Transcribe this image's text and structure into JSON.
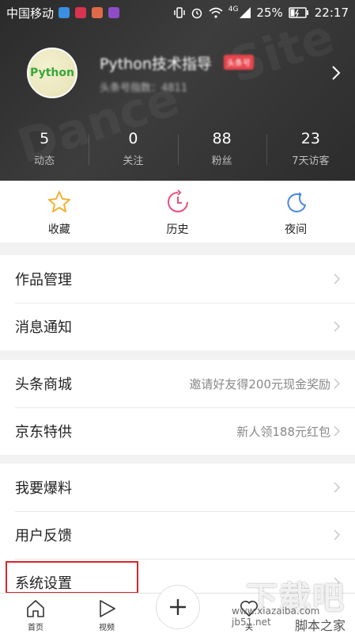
{
  "status_bar": {
    "carrier": "中国移动",
    "network": "4G",
    "battery": "25%",
    "time": "22:17",
    "app_icon_colors": [
      "#3b8fe0",
      "#d9334f",
      "#e0694a",
      "#8f4cc9"
    ]
  },
  "profile": {
    "avatar_text": "Python",
    "name": "Python技术指导",
    "badge": "头条号",
    "subtitle": "头条号指数：4811"
  },
  "stats": [
    {
      "value": "5",
      "label": "动态"
    },
    {
      "value": "0",
      "label": "关注"
    },
    {
      "value": "88",
      "label": "粉丝"
    },
    {
      "value": "23",
      "label": "7天访客"
    }
  ],
  "quick_actions": [
    {
      "label": "收藏",
      "icon": "star-icon",
      "color": "#f2b233"
    },
    {
      "label": "历史",
      "icon": "clock-icon",
      "color": "#e9507c"
    },
    {
      "label": "夜间",
      "icon": "moon-icon",
      "color": "#4a86e0"
    }
  ],
  "groups": [
    [
      {
        "title": "作品管理",
        "extra": ""
      },
      {
        "title": "消息通知",
        "extra": ""
      }
    ],
    [
      {
        "title": "头条商城",
        "extra": "邀请好友得200元现金奖励"
      },
      {
        "title": "京东特供",
        "extra": "新人领188元红包"
      }
    ],
    [
      {
        "title": "我要爆料",
        "extra": ""
      },
      {
        "title": "用户反馈",
        "extra": ""
      },
      {
        "title": "系统设置",
        "extra": ""
      }
    ]
  ],
  "tabbar": [
    {
      "label": "首页",
      "icon": "home-icon"
    },
    {
      "label": "视频",
      "icon": "play-icon"
    },
    {
      "label": "",
      "icon": "plus-icon"
    },
    {
      "label": "关",
      "icon": "heart-icon"
    },
    {
      "label": "",
      "icon": "none"
    }
  ],
  "watermark": {
    "big": "下载吧",
    "site": "www.xiazaiba.com jb51.net",
    "sub": "脚本之家"
  }
}
